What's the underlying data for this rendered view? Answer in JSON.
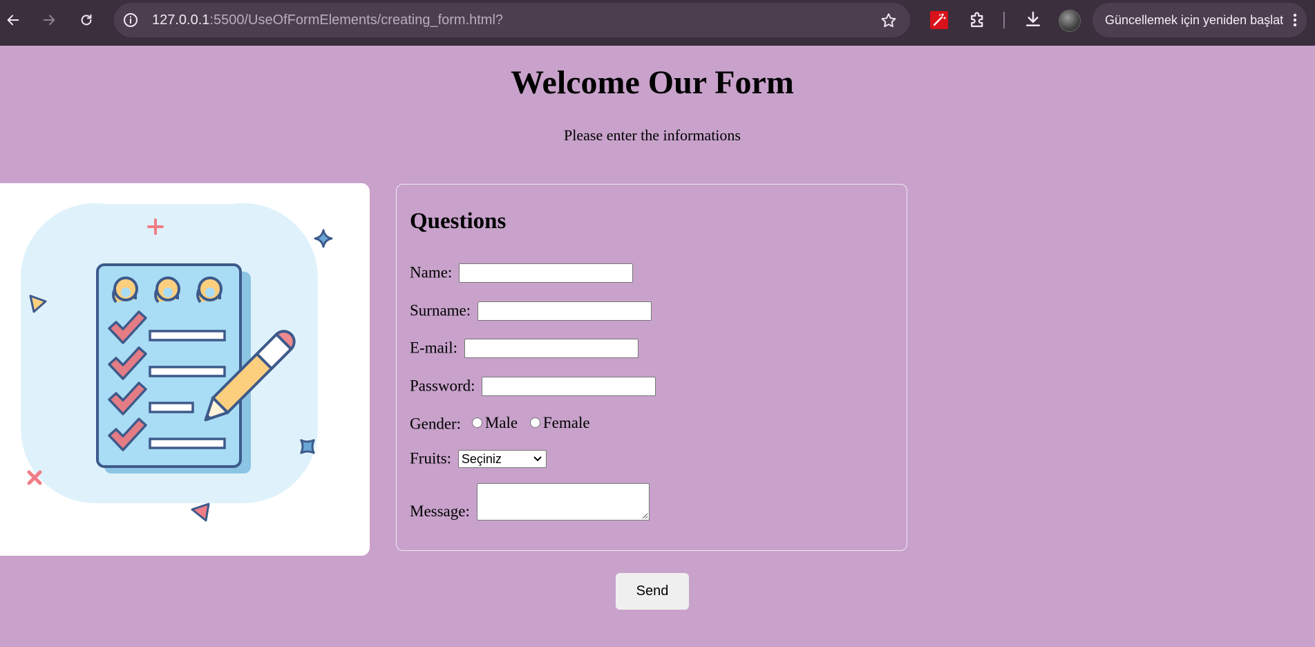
{
  "browser": {
    "url_host": "127.0.0.1",
    "url_rest": ":5500/UseOfFormElements/creating_form.html?",
    "restart_label": "Güncellemek için yeniden başlat"
  },
  "page": {
    "title": "Welcome Our Form",
    "subtitle": "Please enter the informations"
  },
  "form": {
    "heading": "Questions",
    "name_label": "Name:",
    "surname_label": "Surname:",
    "email_label": "E-mail:",
    "password_label": "Password:",
    "gender_label": "Gender:",
    "gender_options": [
      "Male",
      "Female"
    ],
    "fruits_label": "Fruits:",
    "fruits_selected": "Seçiniz",
    "message_label": "Message:",
    "name_value": "",
    "surname_value": "",
    "email_value": "",
    "password_value": "",
    "message_value": ""
  },
  "send_label": "Send",
  "colors": {
    "page_background": "#c8a2cb",
    "chrome_background": "#3b2f3d",
    "illustration_background": "#ffffff",
    "cloud": "#dff2fb",
    "notebook": "#a9dcf5",
    "check": "#e47c85",
    "outline": "#3d5a8a",
    "rings": "#fccf7f"
  }
}
